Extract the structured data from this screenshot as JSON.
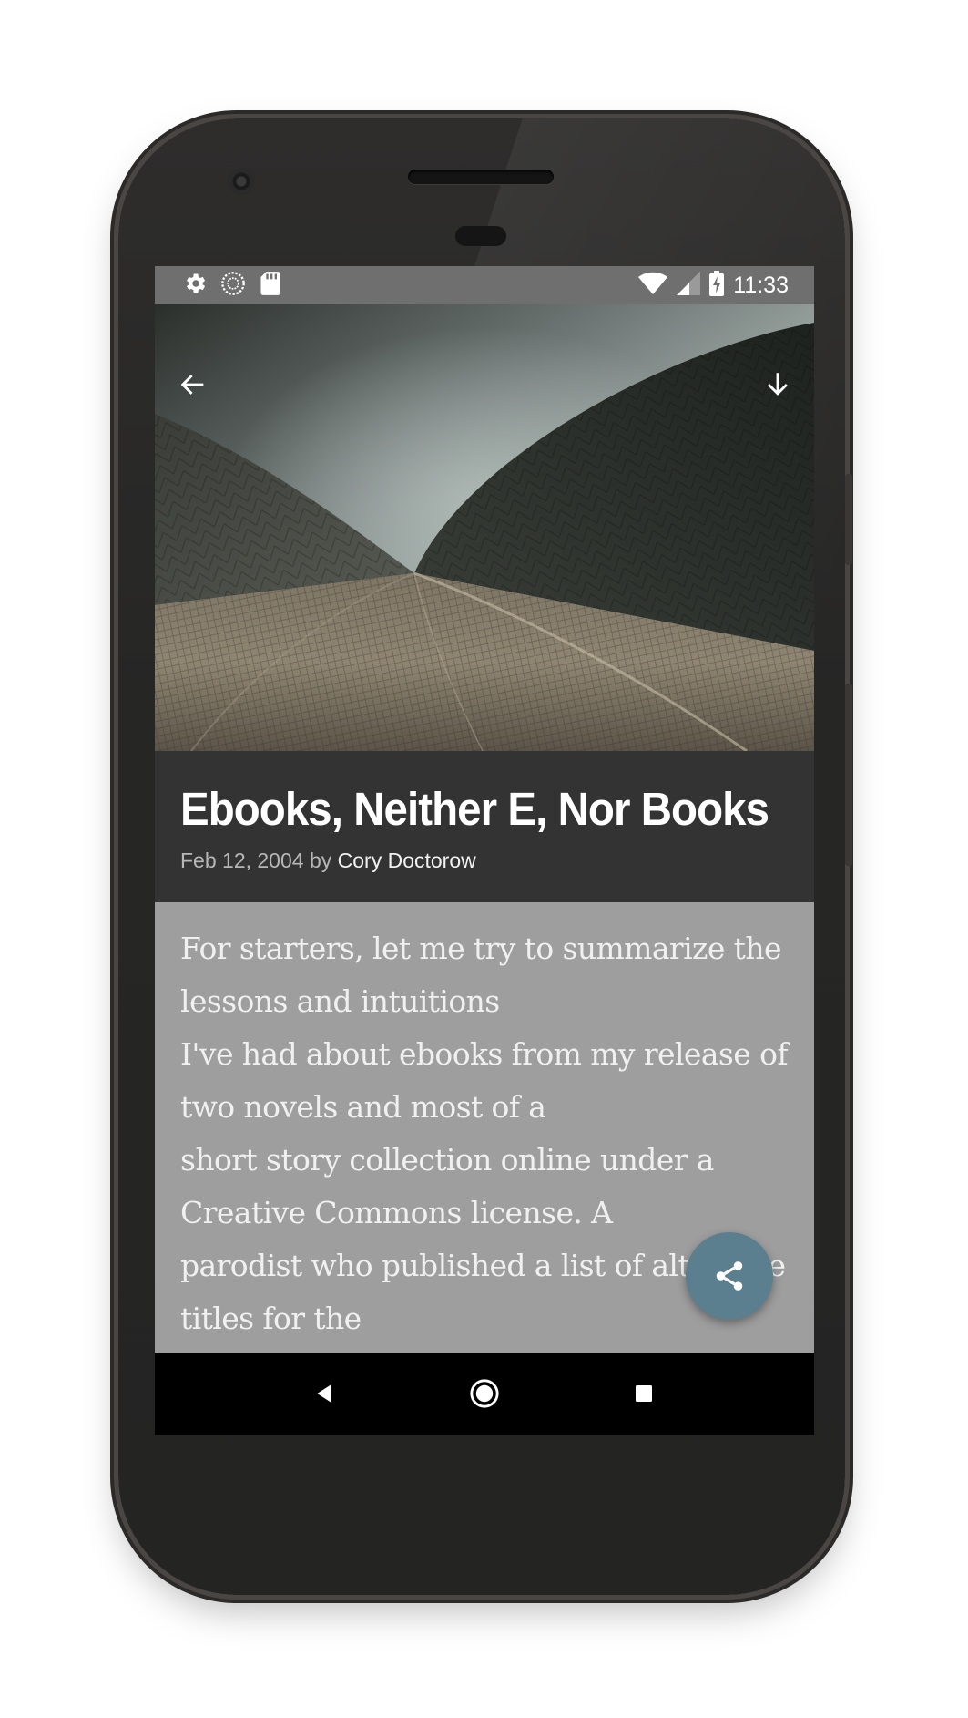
{
  "status_bar": {
    "time": "11:33",
    "left_icons": [
      "settings-icon",
      "sync-icon",
      "sd-card-icon"
    ],
    "right_icons": [
      "wifi-icon",
      "cell-signal-icon",
      "battery-charging-icon"
    ]
  },
  "toolbar": {
    "back_icon": "arrow-back-icon",
    "download_icon": "arrow-download-icon"
  },
  "article": {
    "title": "Ebooks, Neither E, Nor Books",
    "date": "Feb 12, 2004",
    "by": "by",
    "author": "Cory Doctorow",
    "body_lines": [
      "For starters, let me try to summarize the",
      "lessons and intuitions",
      "I've had about ebooks from my release of",
      "two novels and most of a",
      "short story collection online under a",
      "Creative Commons license. A",
      "parodist who published a list of alternate",
      "titles for the"
    ]
  },
  "fab": {
    "icon": "share-icon"
  },
  "nav_bar": {
    "icons": [
      "back-triangle-icon",
      "home-circle-icon",
      "recents-square-icon"
    ]
  },
  "colors": {
    "status_bar": "#6f6f6f",
    "title_block": "#333333",
    "body_background": "#9e9e9e",
    "fab": "#5b7f8f",
    "nav_bar": "#000000",
    "phone_body": "#262625"
  }
}
